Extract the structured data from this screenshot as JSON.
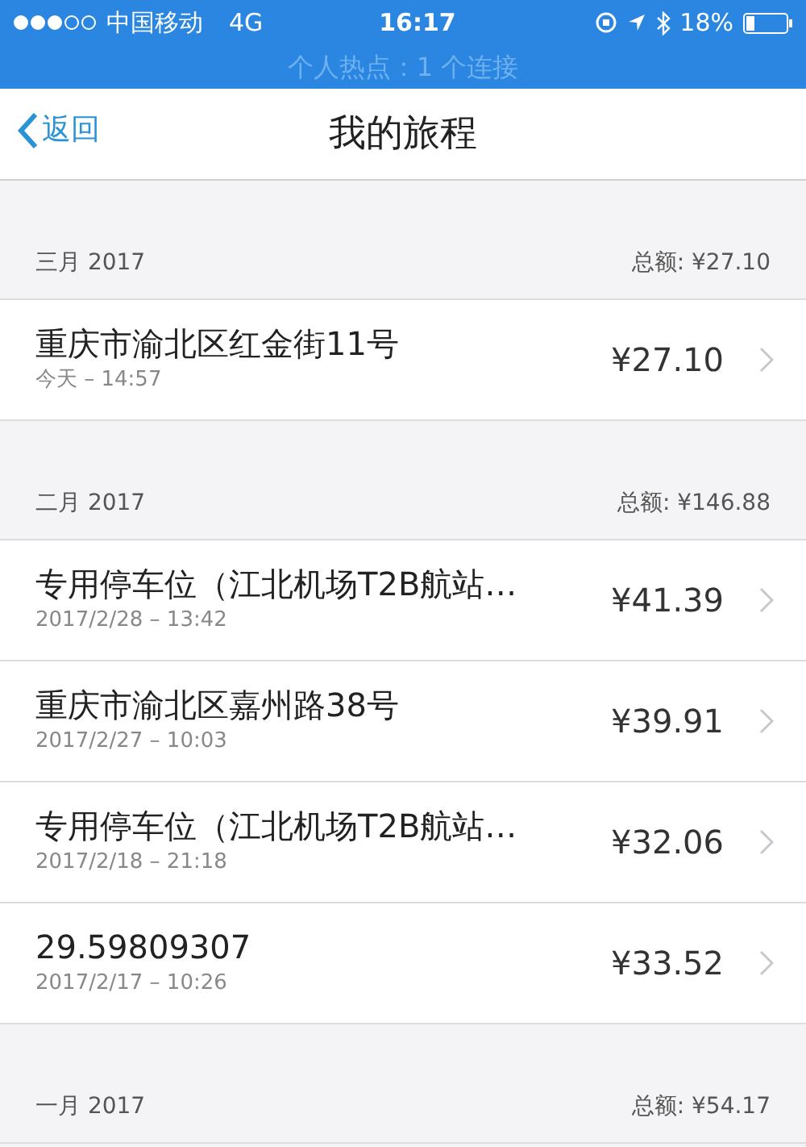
{
  "status_bar": {
    "carrier": "中国移动",
    "network": "4G",
    "time": "16:17",
    "battery": "18%",
    "hotspot": "个人热点：1 个连接"
  },
  "nav": {
    "back": "返回",
    "title": "我的旅程"
  },
  "sections": [
    {
      "month": "三月 2017",
      "total": "总额: ¥27.10",
      "trips": [
        {
          "place": "重庆市渝北区红金街11号",
          "time": "今天 – 14:57",
          "amount": "¥27.10"
        }
      ]
    },
    {
      "month": "二月 2017",
      "total": "总额: ¥146.88",
      "trips": [
        {
          "place": "专用停车位（江北机场T2B航站…",
          "time": "2017/2/28 – 13:42",
          "amount": "¥41.39"
        },
        {
          "place": "重庆市渝北区嘉州路38号",
          "time": "2017/2/27 – 10:03",
          "amount": "¥39.91"
        },
        {
          "place": "专用停车位（江北机场T2B航站…",
          "time": "2017/2/18 – 21:18",
          "amount": "¥32.06"
        },
        {
          "place": "29.59809307",
          "time": "2017/2/17 – 10:26",
          "amount": "¥33.52"
        }
      ]
    },
    {
      "month": "一月 2017",
      "total": "总额: ¥54.17"
    }
  ]
}
